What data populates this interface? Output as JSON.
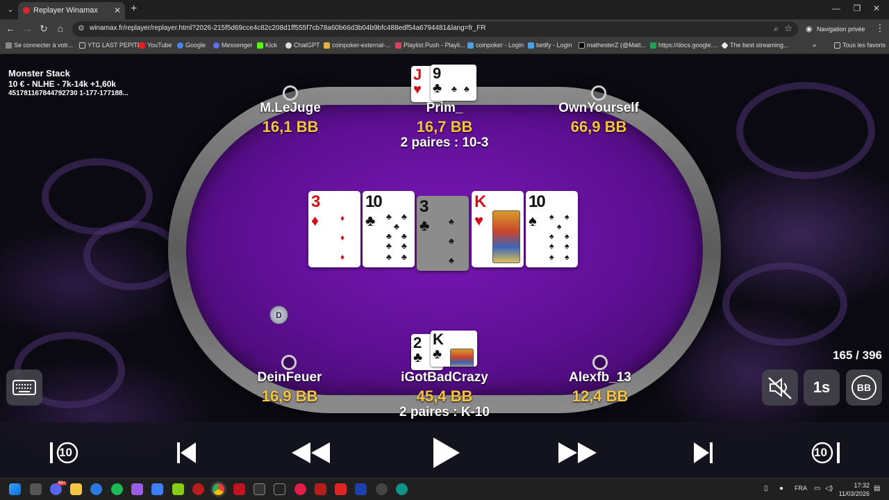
{
  "browser": {
    "tab_title": "Replayer Winamax",
    "url": "winamax.fr/replayer/replayer.html?2026-215f5d69cce4c82c208d1ff555f7cb78a60b66d3b04b9bfc488edf54a6794481&lang=fr_FR",
    "private_label": "Navigation privée",
    "bookmarks": [
      "Se connecter à votr...",
      "YTG LAST PEPITE",
      "YouTube",
      "Google",
      "Messenger",
      "Kick",
      "ChatGPT",
      "coinpoker-external-...",
      "Playlist Push - Playli...",
      "coinpoker - Login",
      "betify - Login",
      "mathesterZ (@Matt...",
      "https://docs.google....",
      "The best streaming...",
      "Tous les favoris"
    ]
  },
  "game": {
    "tournament_name": "Monster Stack",
    "structure": "10 € - NLHE - 7k-14k +1,60k",
    "hand_id": "451781167844792730 1-177-177188...",
    "board": [
      {
        "rank": "3",
        "suit": "♦",
        "color": "#d0101a"
      },
      {
        "rank": "10",
        "suit": "♣",
        "color": "#111111"
      },
      {
        "rank": "3",
        "suit": "♣",
        "color": "#111111"
      },
      {
        "rank": "K",
        "suit": "♥",
        "color": "#d0101a"
      },
      {
        "rank": "10",
        "suit": "♠",
        "color": "#111111"
      }
    ],
    "seats": {
      "top_left": {
        "name": "M.LeJuge",
        "stack": "16,1 BB"
      },
      "top_center": {
        "name": "Prim_",
        "stack": "16,7 BB",
        "hand": "2 paires : 10-3",
        "cards": [
          {
            "rank": "J",
            "suit": "♥"
          },
          {
            "rank": "9",
            "suit": "♣"
          }
        ]
      },
      "top_right": {
        "name": "OwnYourself",
        "stack": "66,9 BB"
      },
      "bottom_left": {
        "name": "DeinFeuer",
        "stack": "16,9 BB"
      },
      "bottom_center": {
        "name": "iGotBadCrazy",
        "stack": "45,4 BB",
        "hand": "2 paires : K-10",
        "cards": [
          {
            "rank": "2",
            "suit": "♣"
          },
          {
            "rank": "K",
            "suit": "♣"
          }
        ]
      },
      "bottom_right": {
        "name": "Alexfb_13",
        "stack": "12,4 BB"
      }
    },
    "dealer_label": "D",
    "action_counter": "165 / 396",
    "speed_label": "1s",
    "bb_label": "BB",
    "skip_back_label": "10",
    "skip_forward_label": "10"
  },
  "taskbar": {
    "language": "FRA",
    "time": "17:32",
    "date": "11/03/2026",
    "discord_badge": "99+"
  }
}
